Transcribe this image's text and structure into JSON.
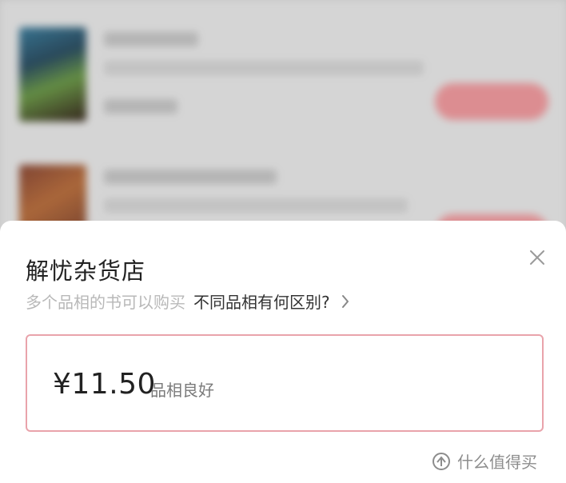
{
  "sheet": {
    "title": "解忧杂货店",
    "subtitle_note": "多个品相的书可以购买",
    "subtitle_link": "不同品相有何区别?",
    "close_icon": "close-icon",
    "chevron_icon": "chevron-right-icon"
  },
  "options": [
    {
      "price": "¥11.50",
      "condition": "品相良好",
      "selected": true
    }
  ],
  "watermark": {
    "text": "什么值得买",
    "icon": "logo-icon"
  },
  "colors": {
    "accent_border": "#e9a3ab",
    "background_button": "#ef9a9e"
  }
}
